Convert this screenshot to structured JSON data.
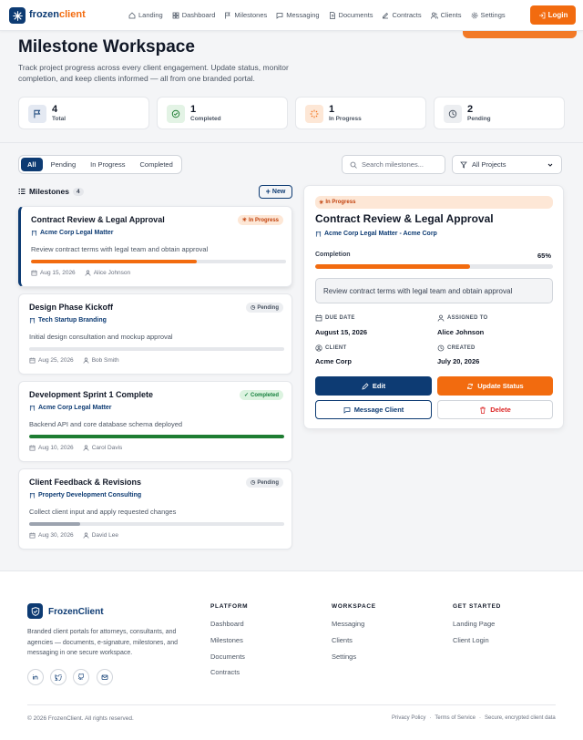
{
  "nav": {
    "brand_part1": "frozen",
    "brand_part2": "client",
    "links": [
      "Landing",
      "Dashboard",
      "Milestones",
      "Messaging",
      "Documents",
      "Contracts",
      "Clients",
      "Settings"
    ],
    "login_label": "Login"
  },
  "hero": {
    "title": "Milestone Workspace",
    "subtitle": "Track project progress across every client engagement. Update status, monitor completion, and keep clients informed — all from one branded portal."
  },
  "stats": [
    {
      "value": "4",
      "label": "Total"
    },
    {
      "value": "1",
      "label": "Completed"
    },
    {
      "value": "1",
      "label": "In Progress"
    },
    {
      "value": "2",
      "label": "Pending"
    }
  ],
  "filters": {
    "tabs": [
      "All",
      "Pending",
      "In Progress",
      "Completed"
    ],
    "active": "All",
    "search_placeholder": "Search milestones...",
    "project_select": "All Projects"
  },
  "list": {
    "heading": "Milestones",
    "count": "4",
    "new_label": "New"
  },
  "milestones": [
    {
      "title": "Contract Review & Legal Approval",
      "status": "In Progress",
      "project": "Acme Corp Legal Matter",
      "description": "Review contract terms with legal team and obtain approval",
      "progress": 0.65,
      "date": "Aug 15, 2026",
      "assignee": "Alice Johnson"
    },
    {
      "title": "Design Phase Kickoff",
      "status": "Pending",
      "project": "Tech Startup Branding",
      "description": "Initial design consultation and mockup approval",
      "progress": 0,
      "date": "Aug 25, 2026",
      "assignee": "Bob Smith"
    },
    {
      "title": "Development Sprint 1 Complete",
      "status": "Completed",
      "project": "Acme Corp Legal Matter",
      "description": "Backend API and core database schema deployed",
      "progress": 1.0,
      "date": "Aug 10, 2026",
      "assignee": "Carol Davis"
    },
    {
      "title": "Client Feedback & Revisions",
      "status": "Pending",
      "project": "Property Development Consulting",
      "description": "Collect client input and apply requested changes",
      "progress": 0.2,
      "date": "Aug 30, 2026",
      "assignee": "David Lee"
    }
  ],
  "detail": {
    "status": "In Progress",
    "title": "Contract Review & Legal Approval",
    "project": "Acme Corp Legal Matter - Acme Corp",
    "completion_label": "Completion",
    "completion_pct": "65%",
    "completion_value": 0.65,
    "description": "Review contract terms with legal team and obtain approval",
    "due_label": "DUE DATE",
    "due_value": "August 15, 2026",
    "assigned_label": "ASSIGNED TO",
    "assigned_value": "Alice Johnson",
    "client_label": "CLIENT",
    "client_value": "Acme Corp",
    "created_label": "CREATED",
    "created_value": "July 20, 2026",
    "edit_label": "Edit",
    "update_label": "Update Status",
    "message_label": "Message Client",
    "delete_label": "Delete"
  },
  "footer": {
    "brand": "FrozenClient",
    "description": "Branded client portals for attorneys, consultants, and agencies — documents, e-signature, milestones, and messaging in one secure workspace.",
    "columns": [
      {
        "heading": "PLATFORM",
        "links": [
          "Dashboard",
          "Milestones",
          "Documents",
          "Contracts"
        ]
      },
      {
        "heading": "WORKSPACE",
        "links": [
          "Messaging",
          "Clients",
          "Settings"
        ]
      },
      {
        "heading": "GET STARTED",
        "links": [
          "Landing Page",
          "Client Login"
        ]
      }
    ],
    "copyright": "© 2026 FrozenClient. All rights reserved.",
    "bottom_links": [
      "Privacy Policy",
      "Terms of Service",
      "Secure, encrypted client data"
    ],
    "separator": "·"
  },
  "colors": {
    "primary": "#0d3b73",
    "accent": "#f26b0f",
    "success": "#1e7d32",
    "muted": "#9ca3af"
  }
}
